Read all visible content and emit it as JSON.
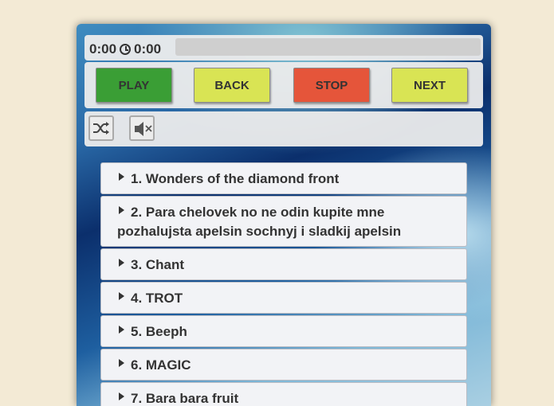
{
  "time": {
    "elapsed": "0:00",
    "duration": "0:00",
    "progress_fraction": 0
  },
  "controls": {
    "play": {
      "label": "PLAY",
      "color": "#3a9e35"
    },
    "back": {
      "label": "BACK",
      "color": "#d9e454"
    },
    "stop": {
      "label": "STOP",
      "color": "#e5553a"
    },
    "next": {
      "label": "NEXT",
      "color": "#d9e454"
    }
  },
  "toggles": {
    "shuffle_icon": "shuffle-icon",
    "mute_icon": "mute-icon"
  },
  "playlist": [
    {
      "label": "1. Wonders of the diamond front"
    },
    {
      "label": "2. Para chelovek no ne odin kupite mne pozhalujsta apelsin sochnyj i sladkij apelsin"
    },
    {
      "label": "3. Chant"
    },
    {
      "label": "4. TROT"
    },
    {
      "label": "5. Beeph"
    },
    {
      "label": "6. MAGIC"
    },
    {
      "label": "7. Bara bara fruit"
    }
  ],
  "colors": {
    "page_background": "#f3ead5",
    "panel_background": "#ececec",
    "track_background": "#f2f3f6"
  }
}
